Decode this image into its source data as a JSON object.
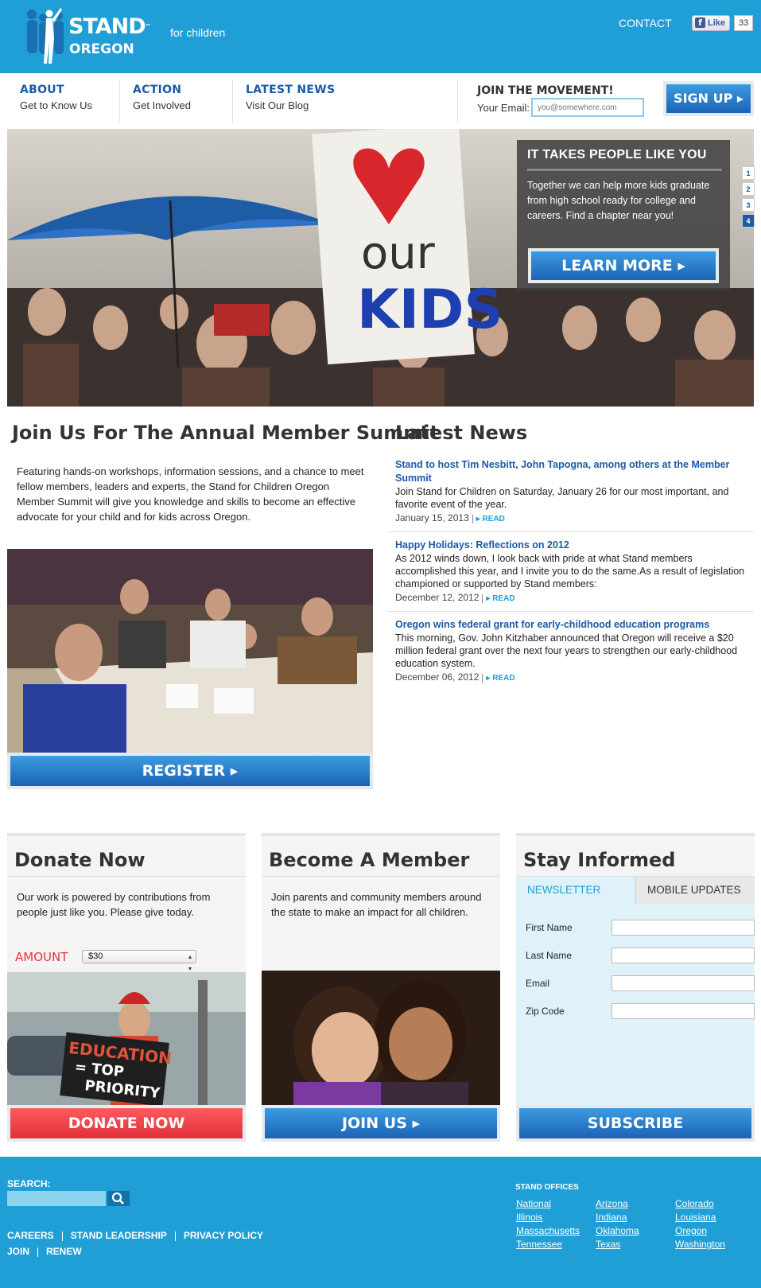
{
  "header": {
    "brand": "STAND",
    "brand_tm": "™",
    "brand_tagline": "for children",
    "brand_state": "OREGON",
    "contact": "CONTACT",
    "fb_like_label": "Like",
    "fb_like_count": "33",
    "brand_color": "#1f9fd6"
  },
  "nav": {
    "items": [
      {
        "title": "ABOUT",
        "sub": "Get to Know Us"
      },
      {
        "title": "ACTION",
        "sub": "Get Involved"
      },
      {
        "title": "LATEST NEWS",
        "sub": "Visit Our Blog"
      }
    ],
    "join_heading": "JOIN THE MOVEMENT!",
    "email_label": "Your Email:",
    "email_placeholder": "you@somewhere.com",
    "signup_label": "SIGN UP ▸"
  },
  "hero": {
    "heading": "IT TAKES PEOPLE LIKE YOU",
    "text": "Together we can help more kids graduate from high school ready for college and careers. Find a chapter near you!",
    "button": "LEARN MORE ▸",
    "slides": [
      "1",
      "2",
      "3",
      "4"
    ],
    "active_slide": "4",
    "sign_text_1": "our",
    "sign_text_2": "KIDS"
  },
  "summit": {
    "title": "Join Us For The Annual Member Summit",
    "text": "Featuring hands-on workshops, information sessions, and a chance to meet fellow members, leaders and experts, the Stand for Children Oregon Member Summit will give you knowledge and skills to become an effective advocate for your child and for kids across Oregon.",
    "button": "REGISTER ▸"
  },
  "news": {
    "title": "Latest News",
    "read_label": "▸ READ",
    "items": [
      {
        "headline": "Stand to host Tim Nesbitt, John Tapogna, among others at the Member Summit",
        "body": "Join Stand for Children on Saturday, January 26 for our most important, and favorite event of the year.",
        "date": "January 15, 2013"
      },
      {
        "headline": "Happy Holidays: Reflections on 2012",
        "body": "As 2012 winds down, I look back with pride at what Stand members accomplished this year, and I invite you to do the same.As a result of legislation championed or supported by Stand members:",
        "date": "December 12, 2012"
      },
      {
        "headline": "Oregon wins federal grant for early-childhood education programs",
        "body": "This morning, Gov. John Kitzhaber announced that Oregon will receive a $20 million federal grant over the next four years to strengthen our early-childhood education system.",
        "date": "December 06, 2012"
      }
    ]
  },
  "donate": {
    "title": "Donate Now",
    "text": "Our work is powered by contributions from people just like you.  Please give today.",
    "amount_label": "AMOUNT",
    "amount_value": "$30",
    "sign_line_1": "EDUCATION",
    "sign_line_2": "= TOP",
    "sign_line_3": "PRIORITY",
    "button": "DONATE NOW",
    "button_color": "#e8343f"
  },
  "member": {
    "title": "Become A Member",
    "text": "Join parents and community members around the state to make an impact for all children.",
    "button": "JOIN US ▸"
  },
  "stay": {
    "title": "Stay Informed",
    "tabs": [
      "NEWSLETTER",
      "MOBILE UPDATES"
    ],
    "active_tab": "NEWSLETTER",
    "fields": [
      "First Name",
      "Last Name",
      "Email",
      "Zip Code"
    ],
    "button": "SUBSCRIBE"
  },
  "footer": {
    "search_label": "SEARCH:",
    "links_row1": [
      "CAREERS",
      "STAND LEADERSHIP",
      "PRIVACY POLICY"
    ],
    "links_row2": [
      "JOIN",
      "RENEW"
    ],
    "offices_title": "STAND OFFICES",
    "offices": [
      "National",
      "Arizona",
      "Colorado",
      "Illinois",
      "Indiana",
      "Louisiana",
      "Massachusetts",
      "Oklahoma",
      "Oregon",
      "Tennessee",
      "Texas",
      "Washington"
    ]
  }
}
